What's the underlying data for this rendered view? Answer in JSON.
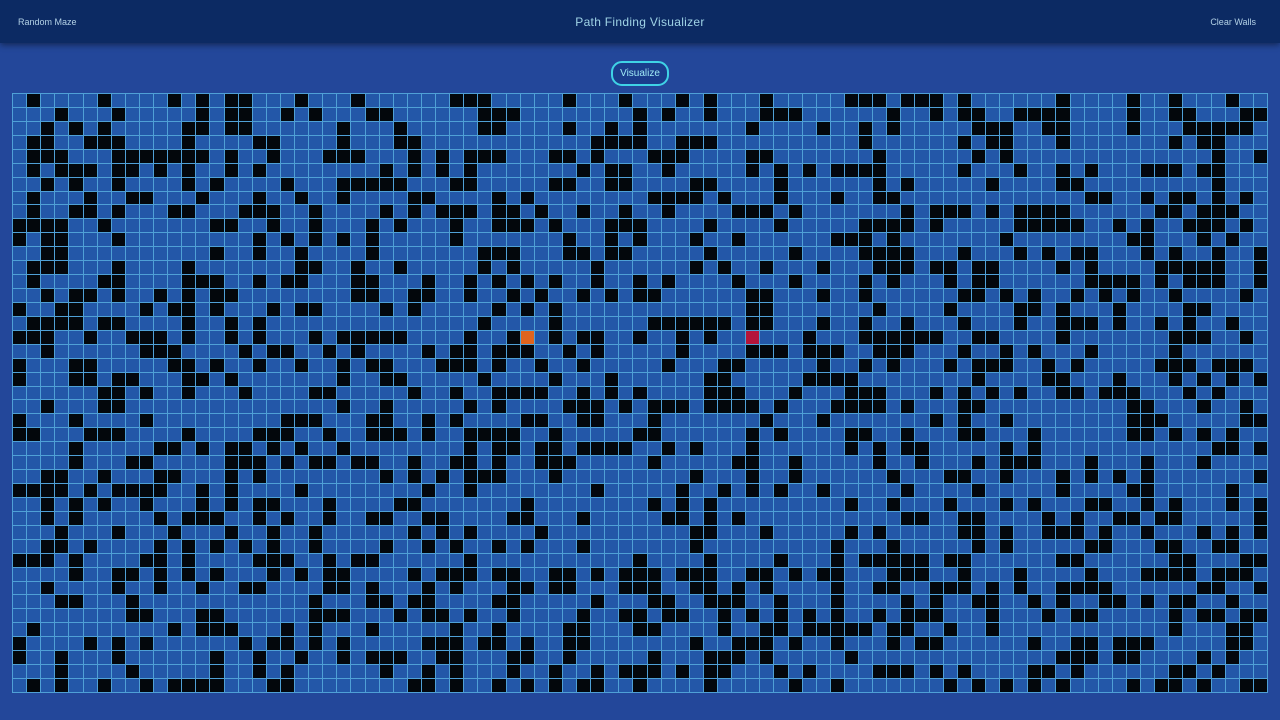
{
  "navbar": {
    "random_maze_label": "Random Maze",
    "title": "Path Finding Visualizer",
    "clear_walls_label": "Clear Walls"
  },
  "controls": {
    "visualize_label": "Visualize"
  },
  "grid": {
    "columns": 89,
    "rows": 43,
    "start": {
      "row": 17,
      "col": 36
    },
    "target": {
      "row": 17,
      "col": 52
    },
    "wall_density": 0.35,
    "colors": {
      "empty": "#2357a8",
      "wall": "#03070c",
      "start": "#e0641d",
      "target": "#b4143a",
      "gridline": "#4fa0d6"
    }
  }
}
